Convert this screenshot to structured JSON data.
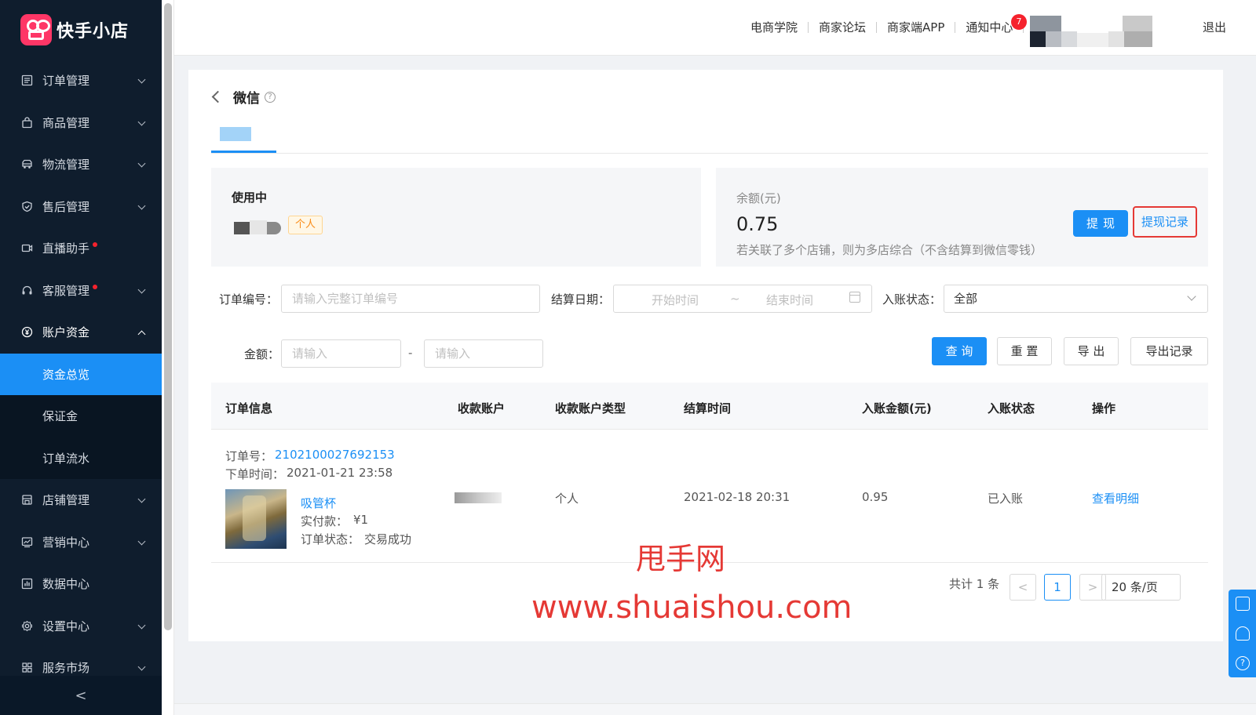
{
  "app": {
    "logo_text": "快手小店"
  },
  "sidebar": {
    "items": [
      {
        "label": "订单管理",
        "icon": "order-icon"
      },
      {
        "label": "商品管理",
        "icon": "bag-icon"
      },
      {
        "label": "物流管理",
        "icon": "truck-icon"
      },
      {
        "label": "售后管理",
        "icon": "shield-icon"
      },
      {
        "label": "直播助手",
        "icon": "video-icon"
      },
      {
        "label": "客服管理",
        "icon": "headset-icon"
      },
      {
        "label": "账户资金",
        "icon": "yen-icon"
      },
      {
        "label": "资金总览"
      },
      {
        "label": "保证金"
      },
      {
        "label": "订单流水"
      },
      {
        "label": "店铺管理",
        "icon": "store-icon"
      },
      {
        "label": "营销中心",
        "icon": "chart-icon"
      },
      {
        "label": "数据中心",
        "icon": "bar-chart-icon"
      },
      {
        "label": "设置中心",
        "icon": "gear-icon"
      },
      {
        "label": "服务市场",
        "icon": "grid-icon"
      }
    ],
    "collapse_label": "<"
  },
  "header": {
    "links": [
      "电商学院",
      "商家论坛",
      "商家端APP",
      "通知中心"
    ],
    "notification_count": "7",
    "logout": "退出"
  },
  "page": {
    "title": "微信",
    "help_glyph": "?",
    "account": {
      "status": "使用中",
      "type_tag": "个人"
    },
    "balance": {
      "label": "余额(元)",
      "value": "0.75",
      "note": "若关联了多个店铺，则为多店综合（不含结算到微信零钱）",
      "withdraw_button": "提现",
      "record_button": "提现记录"
    }
  },
  "filters": {
    "order_no_label": "订单编号：",
    "order_no_placeholder": "请输入完整订单编号",
    "date_label": "结算日期：",
    "start_placeholder": "开始时间",
    "range_sep": "~",
    "end_placeholder": "结束时间",
    "status_label": "入账状态：",
    "status_value": "全部",
    "amount_label": "金额：",
    "amount_min_placeholder": "请输入",
    "amount_sep": "-",
    "amount_max_placeholder": "请输入",
    "query": "查 询",
    "reset": "重 置",
    "export": "导 出",
    "export_record": "导出记录"
  },
  "table": {
    "columns": [
      "订单信息",
      "收款账户",
      "收款账户类型",
      "结算时间",
      "入账金额(元)",
      "入账状态",
      "操作"
    ],
    "rows": [
      {
        "order_no_label": "订单号：",
        "order_no": "2102100027692153",
        "order_time_label": "下单时间：",
        "order_time": "2021-01-21 23:58",
        "product_name": "吸管杯",
        "paid_label": "实付款：",
        "paid": "¥1",
        "order_status_label": "订单状态：",
        "order_status": "交易成功",
        "account_type": "个人",
        "settle_time": "2021-02-18 20:31",
        "amount": "0.95",
        "status": "已入账",
        "action": "查看明细"
      }
    ]
  },
  "pagination": {
    "total_text": "共计 1 条",
    "prev": "<",
    "current_page": "1",
    "next": ">",
    "page_size": "20 条/页"
  },
  "watermark": {
    "line1": "甩手网",
    "line2": "www.shuaishou.com"
  },
  "colors": {
    "primary": "#1b8ff5",
    "sidebar_bg": "#0f1d2d",
    "highlight_border": "#e53935",
    "badge": "#f5222d"
  }
}
